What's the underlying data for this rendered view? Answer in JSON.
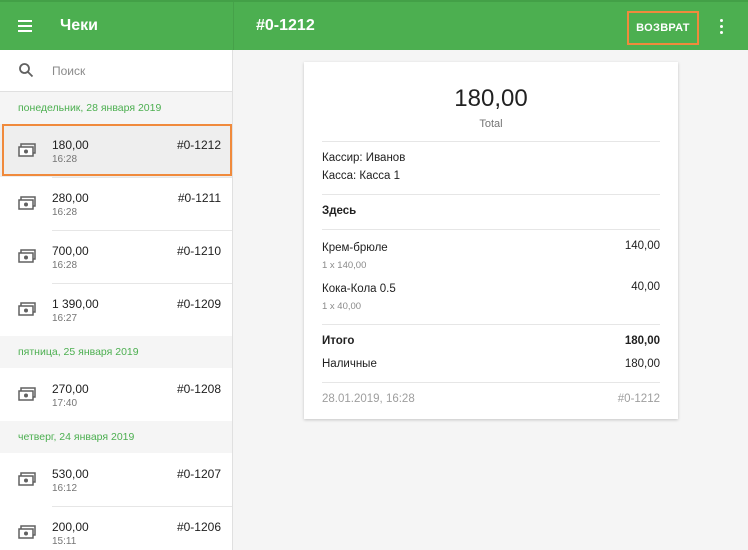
{
  "appbar": {
    "title": "Чеки",
    "receipt_number": "#0-1212",
    "refund_label": "ВОЗВРАТ",
    "menu_icon": "hamburger-menu-icon",
    "more_icon": "more-vert-icon"
  },
  "search": {
    "placeholder": "Поиск"
  },
  "groups": [
    {
      "date": "понедельник, 28 января 2019"
    },
    {
      "date": "пятница, 25 января 2019"
    },
    {
      "date": "четверг, 24 января 2019"
    }
  ],
  "receipts": [
    {
      "amount": "180,00",
      "time": "16:28",
      "number": "#0-1212"
    },
    {
      "amount": "280,00",
      "time": "16:28",
      "number": "#0-1211"
    },
    {
      "amount": "700,00",
      "time": "16:28",
      "number": "#0-1210"
    },
    {
      "amount": "1 390,00",
      "time": "16:27",
      "number": "#0-1209"
    },
    {
      "amount": "270,00",
      "time": "17:40",
      "number": "#0-1208"
    },
    {
      "amount": "530,00",
      "time": "16:12",
      "number": "#0-1207"
    },
    {
      "amount": "200,00",
      "time": "15:11",
      "number": "#0-1206"
    }
  ],
  "detail": {
    "total_amount": "180,00",
    "total_label": "Total",
    "cashier": "Кассир: Иванов",
    "register": "Касса: Касса 1",
    "dining_option": "Здесь",
    "items": [
      {
        "name": "Крем-брюле",
        "qty": "1 x 140,00",
        "price": "140,00"
      },
      {
        "name": "Кока-Кола 0.5",
        "qty": "1 x 40,00",
        "price": "40,00"
      }
    ],
    "subtotal_label": "Итого",
    "subtotal_value": "180,00",
    "payment_label": "Наличные",
    "payment_value": "180,00",
    "datetime": "28.01.2019, 16:28",
    "number": "#0-1212"
  },
  "colors": {
    "primary": "#4caf50",
    "highlight": "#f08a3c"
  }
}
